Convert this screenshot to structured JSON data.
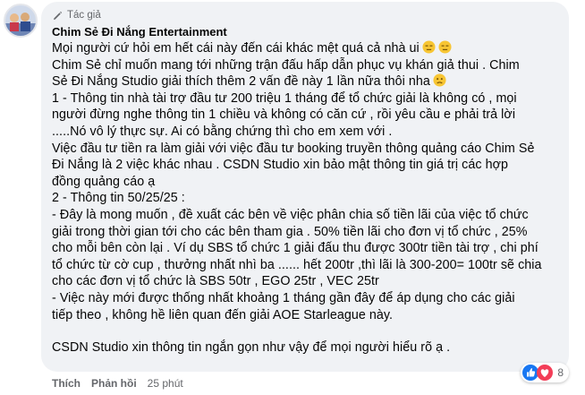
{
  "comment": {
    "author_badge": "Tác giả",
    "author_name": "Chim Sẻ Đi Nắng Entertainment",
    "lines": [
      "Mọi người cứ hỏi em hết cái này đến cái khác mệt quá cả nhà ui",
      "Chim Sẻ chỉ muốn mang tới những trận đấu hấp dẫn phục vụ khán giả thui . Chim",
      "Sẻ Đi Nắng Studio giải thích thêm 2 vấn đề này 1 lần nữa thôi nha",
      "1 - Thông tin nhà tài trợ đầu tư 200 triệu 1 tháng để tổ chức giải là không có , mọi",
      "người đừng nghe thông tin 1 chiều và không có căn cứ , rồi yêu cầu e phải trả lời",
      ".....Nó vô lý thực sự. Ai có bằng chứng thì cho em xem với .",
      "Việc đầu tư tiền ra làm giải với việc đầu tư booking truyền thông quảng cáo Chim Sẻ",
      "Đi Nắng là 2 việc khác nhau . CSDN Studio xin bảo mật thông tin giá trị các hợp",
      "đồng quảng cáo ạ",
      "2 - Thông tin 50/25/25 :",
      "- Đây là mong muốn , đề xuất các bên về việc phân chia số tiền lãi của việc tổ chức",
      "giải trong thời gian tới cho các bên tham gia . 50% tiền lãi cho đơn vị tổ chức , 25%",
      "cho mỗi bên còn lại . Ví dụ SBS tổ chức 1 giải đấu thu được 300tr tiền tài trợ , chi phí",
      "tổ chức từ cờ cup , thưởng nhất nhì ba ...... hết 200tr ,thì lãi là 300-200= 100tr sẽ chia",
      "cho các đơn vị tổ chức là SBS 50tr , EGO 25tr , VEC 25tr",
      "- Việc này mới được thống nhất khoảng 1 tháng gần đây để áp dụng cho các giải",
      "tiếp theo , không hề liên quan đến giải AOE Starleague này.",
      "",
      "CSDN Studio xin thông tin ngắn gọn như vậy để mọi người hiểu rõ ạ ."
    ],
    "emoji_after_line": {
      "0": [
        "expressionless-face",
        "expressionless-face"
      ],
      "2": [
        "slightly-frowning-face"
      ]
    }
  },
  "actions": {
    "like_label": "Thích",
    "reply_label": "Phản hồi",
    "time_label": "25 phút"
  },
  "reactions": {
    "icons": [
      "like-icon",
      "love-icon"
    ],
    "count": "8"
  },
  "colors": {
    "bubble": "#f0f2f5",
    "text": "#050505",
    "muted": "#65676b",
    "like_blue": "#1877f2",
    "love_red": "#f33e58"
  }
}
